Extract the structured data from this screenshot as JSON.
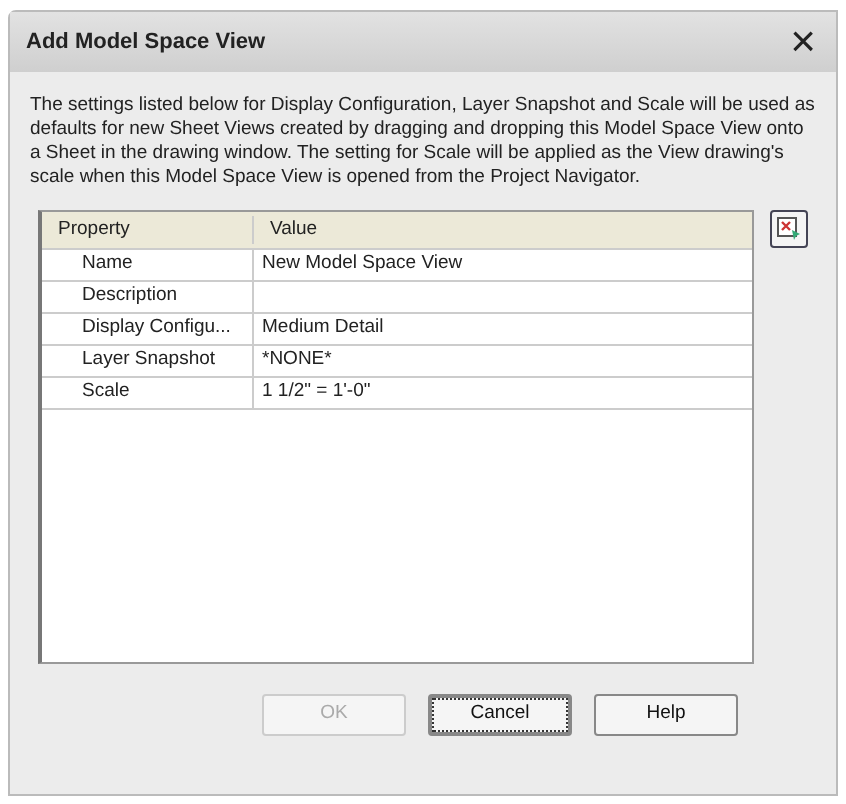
{
  "window": {
    "title": "Add Model Space View",
    "close": "×"
  },
  "description": "The settings listed below for Display Configuration, Layer Snapshot and Scale will be used as defaults for new Sheet Views created by dragging and dropping this Model Space View onto a Sheet in the drawing window. The setting for Scale will be applied as the View drawing's scale when this Model Space View is opened from the Project Navigator.",
  "table": {
    "columns": [
      "Property",
      "Value"
    ],
    "rows": [
      {
        "property": "Name",
        "value": "New Model Space View"
      },
      {
        "property": "Description"
      },
      {
        "property": "Display Configu...",
        "value": "Medium Detail"
      },
      {
        "property": "Layer Snapshot",
        "value": "*NONE*"
      },
      {
        "property": "Scale",
        "value": "1 1/2\" = 1'-0\""
      }
    ]
  },
  "buttons": [
    {
      "label": "OK",
      "disabled": true,
      "focused": false
    },
    {
      "label": "Cancel",
      "disabled": false,
      "focused": true
    },
    {
      "label": "Help",
      "disabled": false,
      "focused": false
    }
  ]
}
